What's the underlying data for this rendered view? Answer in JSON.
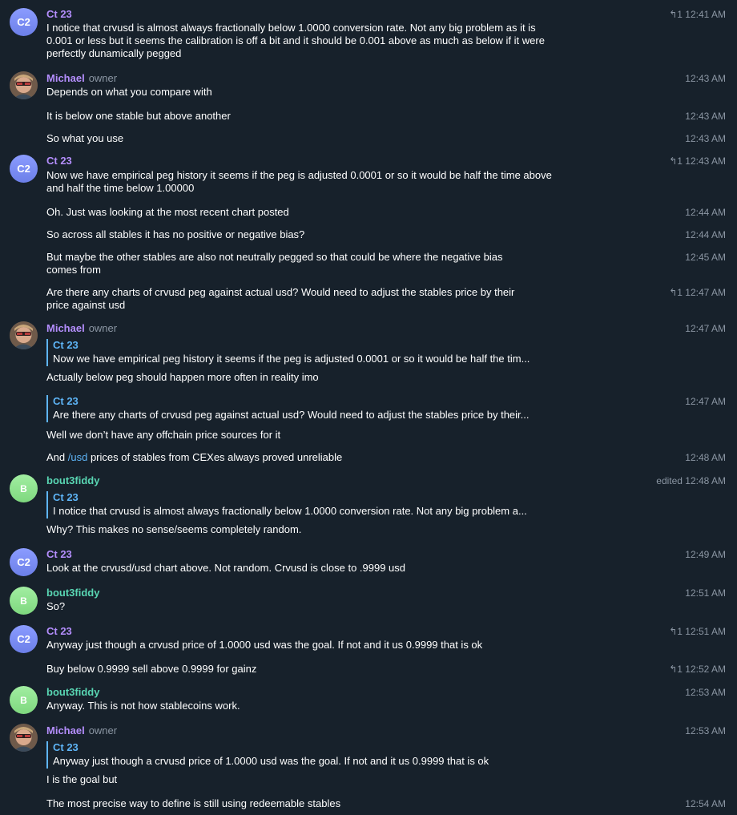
{
  "users": {
    "ct23": {
      "name": "Ct 23",
      "initials": "C2"
    },
    "michael": {
      "name": "Michael",
      "role": "owner"
    },
    "bout": {
      "name": "bout3fiddy",
      "initials": "B"
    }
  },
  "reply_glyph": "↰",
  "messages": [
    {
      "text": "I notice that crvusd is almost always fractionally below 1.0000 conversion rate. Not any big problem as it is 0.001 or less but it seems the calibration is off a bit and it should be 0.001 above as much as below if it were perfectly dunamically pegged",
      "time": "1 12:41 AM"
    },
    {
      "text": "Depends on what you compare with",
      "time": "12:43 AM"
    },
    {
      "text": "It is below one stable but above another",
      "time": "12:43 AM"
    },
    {
      "text": "So what you use",
      "time": "12:43 AM"
    },
    {
      "text": "Now we have empirical peg history it seems if the peg is adjusted 0.0001 or so it would be half the time above and half the time below 1.00000",
      "time": "1 12:43 AM"
    },
    {
      "text": "Oh. Just was looking at the most recent chart posted",
      "time": "12:44 AM"
    },
    {
      "text": "So across all stables it has no positive or negative bias?",
      "time": "12:44 AM"
    },
    {
      "text": "But maybe the other stables are also not neutrally pegged so that could be where the negative bias comes from",
      "time": "12:45 AM"
    },
    {
      "text": "Are there any charts of crvusd peg against actual usd? Would need to adjust the stables price by their price against usd",
      "time": "1 12:47 AM"
    },
    {
      "quote_name": "Ct 23",
      "quote_text": "Now we have empirical peg history it seems if the peg is adjusted 0.0001 or so it would be half the tim...",
      "text": "Actually below peg should happen more often in reality imo",
      "time": "12:47 AM"
    },
    {
      "quote_name": "Ct 23",
      "quote_text": "Are there any charts of crvusd peg against actual usd? Would need to adjust the stables price by their...",
      "text": "Well we don’t have any offchain price sources for it",
      "time": "12:47 AM"
    },
    {
      "text_pre": "And ",
      "link": "/usd",
      "text_post": " prices of stables from CEXes always proved  unreliable",
      "time": "12:48 AM"
    },
    {
      "quote_name": "Ct 23",
      "quote_text": "I notice that crvusd is almost always fractionally below 1.0000 conversion rate. Not any big problem a...",
      "text": "Why? This makes no sense/seems completely random.",
      "time": "edited 12:48 AM"
    },
    {
      "text": "Look at the crvusd/usd chart above. Not random. Crvusd is close to .9999 usd",
      "time": "12:49 AM"
    },
    {
      "text": "So?",
      "time": "12:51 AM"
    },
    {
      "text": "Anyway just though a crvusd price of 1.0000 usd was the goal. If not and it us 0.9999 that is ok",
      "time": "1 12:51 AM"
    },
    {
      "text": "Buy below 0.9999 sell above 0.9999 for gainz",
      "time": "1 12:52 AM"
    },
    {
      "text": "Anyway. This is not how stablecoins work.",
      "time": "12:53 AM"
    },
    {
      "quote_name": "Ct 23",
      "quote_text": "Anyway just though a crvusd price of 1.0000 usd was the goal. If not and it us 0.9999 that is ok",
      "text": "I is the goal but",
      "time": "12:53 AM"
    },
    {
      "text": "The most precise way to define is still using redeemable stables",
      "time": "12:54 AM"
    }
  ]
}
